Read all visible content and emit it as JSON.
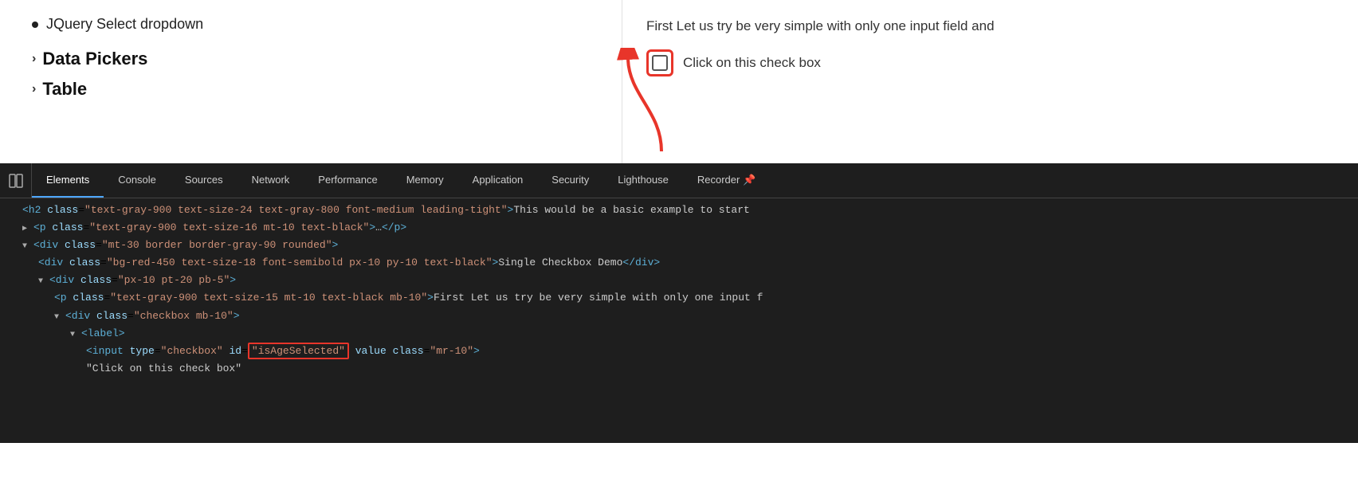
{
  "preview": {
    "bullet_item": "JQuery Select dropdown",
    "section_heading": "Data Pickers",
    "table_heading": "Table",
    "preview_text": "First Let us try be very simple with only one input field and",
    "checkbox_label": "Click on this check box"
  },
  "devtools": {
    "tabs": [
      {
        "id": "elements",
        "label": "Elements",
        "active": true
      },
      {
        "id": "console",
        "label": "Console",
        "active": false
      },
      {
        "id": "sources",
        "label": "Sources",
        "active": false
      },
      {
        "id": "network",
        "label": "Network",
        "active": false
      },
      {
        "id": "performance",
        "label": "Performance",
        "active": false
      },
      {
        "id": "memory",
        "label": "Memory",
        "active": false
      },
      {
        "id": "application",
        "label": "Application",
        "active": false
      },
      {
        "id": "security",
        "label": "Security",
        "active": false
      },
      {
        "id": "lighthouse",
        "label": "Lighthouse",
        "active": false
      },
      {
        "id": "recorder",
        "label": "Recorder",
        "active": false
      }
    ],
    "code_lines": [
      {
        "indent": 1,
        "html": "<span class='tag'>&lt;h2</span> <span class='attr-name'>class</span><span class='tag-bracket'>=</span><span class='attr-value'>\"text-gray-900 text-size-24 text-gray-800 font-medium leading-tight\"</span><span class='tag'>&gt;</span><span class='text-content'>This would be a basic example to start</span>"
      },
      {
        "indent": 1,
        "html": "<span class='triangle'>▶</span><span class='tag'>&lt;p</span> <span class='attr-name'>class</span><span class='tag-bracket'>=</span><span class='attr-value'>\"text-gray-900 text-size-16 mt-10 text-black\"</span><span class='tag'>&gt;</span><span class='text-content'>…</span><span class='tag'>&lt;/p&gt;</span>"
      },
      {
        "indent": 1,
        "html": "<span class='triangle'>▼</span><span class='tag'>&lt;div</span> <span class='attr-name'>class</span><span class='tag-bracket'>=</span><span class='attr-value'>\"mt-30 border border-gray-90 rounded\"</span><span class='tag'>&gt;</span>"
      },
      {
        "indent": 2,
        "html": "<span class='tag'>&lt;div</span> <span class='attr-name'>class</span><span class='tag-bracket'>=</span><span class='attr-value'>\"bg-red-450 text-size-18 font-semibold px-10 py-10 text-black\"</span><span class='tag'>&gt;</span><span class='text-content'>Single Checkbox Demo</span><span class='tag'>&lt;/div&gt;</span>"
      },
      {
        "indent": 2,
        "html": "<span class='triangle'>▼</span><span class='tag'>&lt;div</span> <span class='attr-name'>class</span><span class='tag-bracket'>=</span><span class='attr-value'>\"px-10 pt-20 pb-5\"</span><span class='tag'>&gt;</span>"
      },
      {
        "indent": 3,
        "html": "<span class='tag'>&lt;p</span> <span class='attr-name'>class</span><span class='tag-bracket'>=</span><span class='attr-value'>\"text-gray-900 text-size-15 mt-10 text-black mb-10\"</span><span class='tag'>&gt;</span><span class='text-content'>First Let us try be very simple with only one input f</span>"
      },
      {
        "indent": 3,
        "html": "<span class='triangle'>▼</span><span class='tag'>&lt;div</span> <span class='attr-name'>class</span><span class='tag-bracket'>=</span><span class='attr-value'>\"checkbox mb-10\"</span><span class='tag'>&gt;</span>"
      },
      {
        "indent": 4,
        "html": "<span class='triangle'>▼</span><span class='tag'>&lt;label&gt;</span>"
      },
      {
        "indent": 5,
        "html": "<span class='tag'>&lt;input</span> <span class='attr-name'>type</span><span class='tag-bracket'>=</span><span class='attr-value'>\"checkbox\"</span> <span class='attr-name'>id</span><span class='tag-bracket'>=</span><span class='highlight-box'><span class='attr-value'>\"isAgeSelected\"</span></span> <span class='attr-name'>value</span> <span class='attr-name'>class</span><span class='tag-bracket'>=</span><span class='attr-value'>\"mr-10\"</span><span class='tag'>&gt;</span>"
      },
      {
        "indent": 5,
        "html": "<span class='text-content'>\"Click on this check box\"</span>"
      }
    ]
  }
}
